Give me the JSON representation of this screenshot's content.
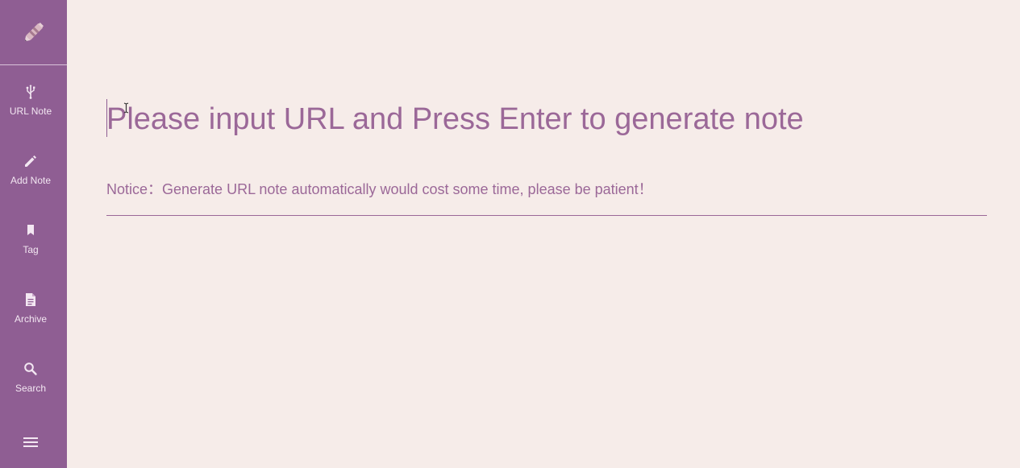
{
  "sidebar": {
    "logo_icon": "pen-logo-icon",
    "items": [
      {
        "label": "URL Note",
        "icon": "usb-icon"
      },
      {
        "label": "Add Note",
        "icon": "pencil-icon"
      },
      {
        "label": "Tag",
        "icon": "bookmark-icon"
      },
      {
        "label": "Archive",
        "icon": "document-icon"
      },
      {
        "label": "Search",
        "icon": "search-icon"
      }
    ],
    "menu_icon": "hamburger-menu-icon"
  },
  "main": {
    "url_input": {
      "value": "",
      "placeholder": "Please input URL and Press Enter to generate note"
    },
    "notice": "Notice：Generate URL note automatically would cost some time, please be patient！"
  },
  "colors": {
    "sidebar_bg": "#8f5e93",
    "page_bg": "#f6ece9",
    "accent_text": "#9b6898"
  }
}
